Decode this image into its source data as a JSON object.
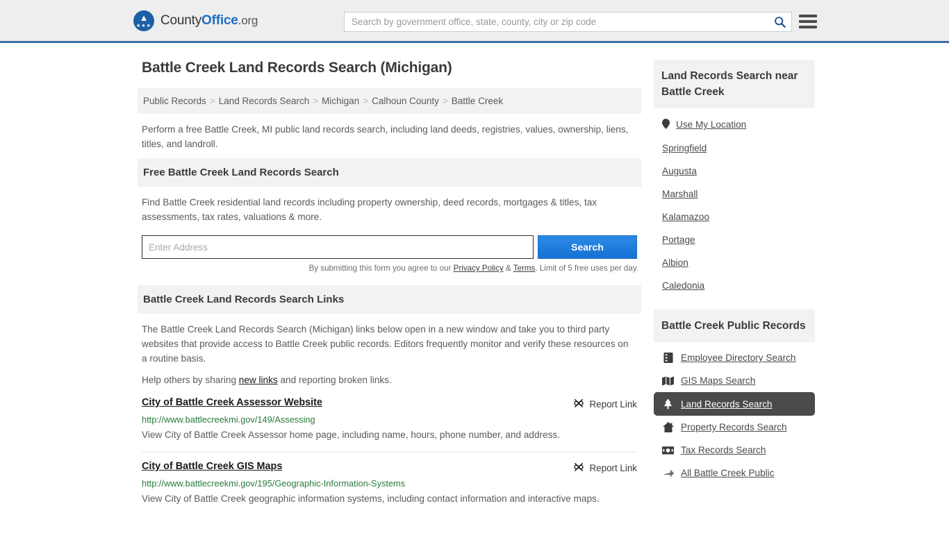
{
  "header": {
    "brand": {
      "part1": "County",
      "part2": "Office",
      "tld": ".org"
    },
    "search": {
      "placeholder": "Search by government office, state, county, city or zip code",
      "value": "",
      "icon": "search-icon"
    },
    "menu_icon": "hamburger-menu-icon",
    "accent_color": "#3a71a8"
  },
  "main": {
    "page_title": "Battle Creek Land Records Search (Michigan)",
    "breadcrumb": [
      "Public Records",
      "Land Records Search",
      "Michigan",
      "Calhoun County",
      "Battle Creek"
    ],
    "breadcrumb_separator": ">",
    "intro": "Perform a free Battle Creek, MI public land records search, including land deeds, registries, values, ownership, liens, titles, and landroll.",
    "free_search": {
      "heading": "Free Battle Creek Land Records Search",
      "description": "Find Battle Creek residential land records including property ownership, deed records, mortgages & titles, tax assessments, tax rates, valuations & more.",
      "input_placeholder": "Enter Address",
      "input_value": "",
      "button_label": "Search",
      "button_color": "#1f7fe0",
      "fine_print_prefix": "By submitting this form you agree to our ",
      "privacy_label": "Privacy Policy",
      "fine_print_mid": " & ",
      "terms_label": "Terms",
      "fine_print_suffix": ". Limit of 5 free uses per day."
    },
    "links_section": {
      "heading": "Battle Creek Land Records Search Links",
      "paragraph": "The Battle Creek Land Records Search (Michigan) links below open in a new window and take you to third party websites that provide access to Battle Creek public records. Editors frequently monitor and verify these resources on a routine basis.",
      "help_prefix": "Help others by sharing ",
      "help_link": "new links",
      "help_suffix": " and reporting broken links.",
      "report_label": "Report Link",
      "report_icon": "broken-link-icon",
      "items": [
        {
          "title": "City of Battle Creek Assessor Website",
          "url": "http://www.battlecreekmi.gov/149/Assessing",
          "description": "View City of Battle Creek Assessor home page, including name, hours, phone number, and address."
        },
        {
          "title": "City of Battle Creek GIS Maps",
          "url": "http://www.battlecreekmi.gov/195/Geographic-Information-Systems",
          "description": "View City of Battle Creek geographic information systems, including contact information and interactive maps."
        }
      ]
    }
  },
  "sidebar": {
    "near": {
      "heading": "Land Records Search near Battle Creek",
      "use_my_location": "Use My Location",
      "location_icon": "map-pin-icon",
      "cities": [
        "Springfield",
        "Augusta",
        "Marshall",
        "Kalamazoo",
        "Portage",
        "Albion",
        "Caledonia"
      ]
    },
    "public_records": {
      "heading": "Battle Creek Public Records",
      "items": [
        {
          "label": "Employee Directory Search",
          "icon": "directory-book-icon",
          "active": false
        },
        {
          "label": "GIS Maps Search",
          "icon": "map-icon",
          "active": false
        },
        {
          "label": "Land Records Search",
          "icon": "tree-icon",
          "active": true
        },
        {
          "label": "Property Records Search",
          "icon": "house-icon",
          "active": false
        },
        {
          "label": "Tax Records Search",
          "icon": "money-icon",
          "active": false
        },
        {
          "label": "All Battle Creek Public",
          "icon": "arrow-right-icon",
          "active": false
        }
      ],
      "active_background": "#4a4a4a"
    }
  }
}
